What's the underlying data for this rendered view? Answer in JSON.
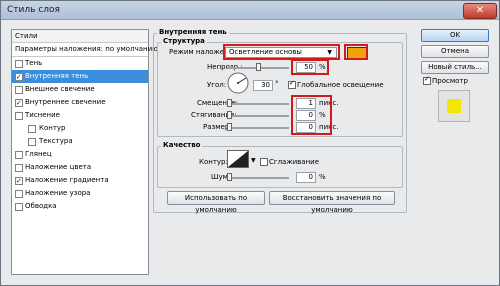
{
  "window": {
    "title": "Стиль слоя",
    "close_glyph": "✕"
  },
  "styles_panel": {
    "header": "Стили",
    "items": [
      {
        "label": "Параметры наложения: по умолчанию",
        "checkbox": false,
        "checked": false,
        "indent": false,
        "selected": false
      },
      {
        "label": "Тень",
        "checkbox": true,
        "checked": false,
        "indent": false,
        "selected": false
      },
      {
        "label": "Внутренняя тень",
        "checkbox": true,
        "checked": true,
        "indent": false,
        "selected": true
      },
      {
        "label": "Внешнее свечение",
        "checkbox": true,
        "checked": false,
        "indent": false,
        "selected": false
      },
      {
        "label": "Внутреннее свечение",
        "checkbox": true,
        "checked": true,
        "indent": false,
        "selected": false
      },
      {
        "label": "Тиснение",
        "checkbox": true,
        "checked": false,
        "indent": false,
        "selected": false
      },
      {
        "label": "Контур",
        "checkbox": true,
        "checked": false,
        "indent": true,
        "selected": false
      },
      {
        "label": "Текстура",
        "checkbox": true,
        "checked": false,
        "indent": true,
        "selected": false
      },
      {
        "label": "Глянец",
        "checkbox": true,
        "checked": false,
        "indent": false,
        "selected": false
      },
      {
        "label": "Наложение цвета",
        "checkbox": true,
        "checked": false,
        "indent": false,
        "selected": false
      },
      {
        "label": "Наложение градиента",
        "checkbox": true,
        "checked": true,
        "indent": false,
        "selected": false
      },
      {
        "label": "Наложение узора",
        "checkbox": true,
        "checked": false,
        "indent": false,
        "selected": false
      },
      {
        "label": "Обводка",
        "checkbox": true,
        "checked": false,
        "indent": false,
        "selected": false
      }
    ]
  },
  "main": {
    "section_title": "Внутренняя тень",
    "structure": {
      "title": "Структура",
      "blend_mode_label": "Режим наложения:",
      "blend_mode_value": "Осветление основы",
      "swatch_color": "#f0a30a",
      "opacity_label": "Непрозр.:",
      "opacity_value": "50",
      "opacity_level": 0.5,
      "opacity_unit": "%",
      "angle_label": "Угол:",
      "angle_value": "30",
      "angle_unit": "°",
      "global_light_label": "Глобальное освещение",
      "global_light_checked": true,
      "offset_label": "Смещение:",
      "offset_value": "1",
      "offset_unit": "пикс.",
      "choke_label": "Стягивание:",
      "choke_value": "0",
      "choke_unit": "%",
      "size_label": "Размер:",
      "size_value": "0",
      "size_unit": "пикс."
    },
    "quality": {
      "title": "Качество",
      "contour_label": "Контур:",
      "antialias_label": "Сглаживание",
      "noise_label": "Шум:",
      "noise_value": "0",
      "noise_unit": "%"
    },
    "default_button": "Использовать по умолчанию",
    "reset_button": "Восстановить значения по умолчанию"
  },
  "right": {
    "ok": "OK",
    "cancel": "Отмена",
    "new_style": "Новый стиль...",
    "preview_label": "Просмотр",
    "preview_checked": true,
    "preview_color": "#f3e600"
  },
  "accent": "#d11a1a"
}
